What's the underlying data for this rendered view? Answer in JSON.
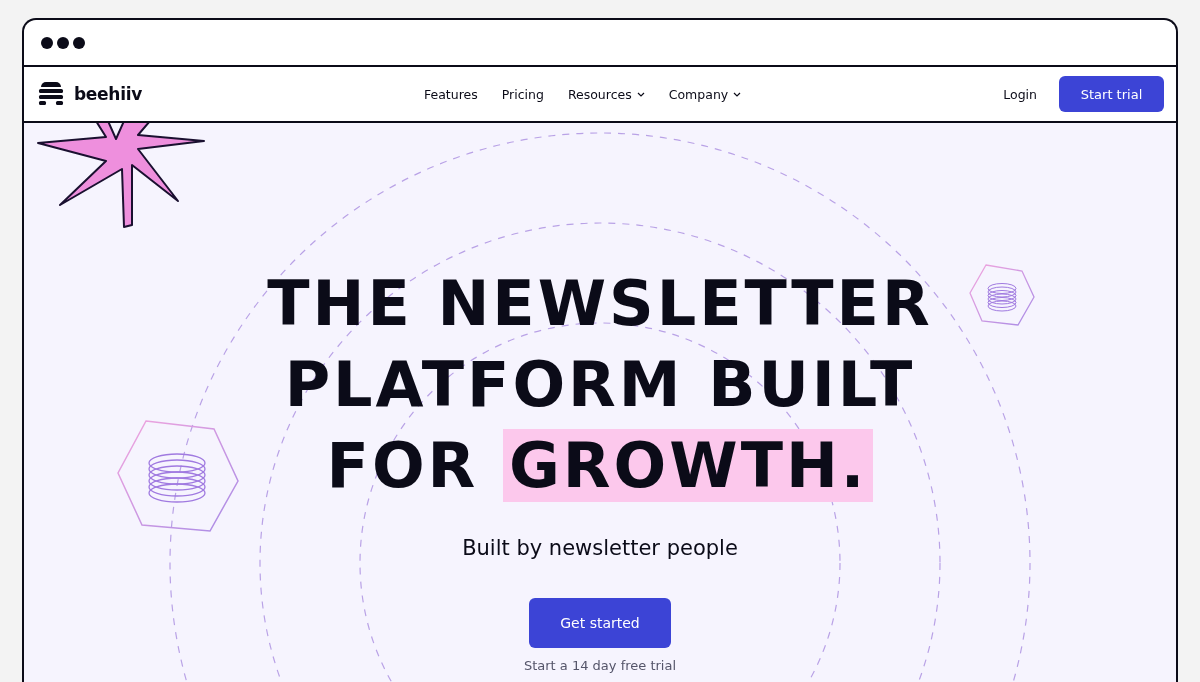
{
  "brand": {
    "name": "beehiiv"
  },
  "nav": {
    "links": [
      {
        "label": "Features",
        "has_dropdown": false
      },
      {
        "label": "Pricing",
        "has_dropdown": false
      },
      {
        "label": "Resources",
        "has_dropdown": true
      },
      {
        "label": "Company",
        "has_dropdown": true
      }
    ],
    "login": "Login",
    "cta": "Start trial"
  },
  "hero": {
    "headline_lines": [
      "THE NEWSLETTER",
      "PLATFORM BUILT"
    ],
    "headline_last": "FOR",
    "headline_highlight": "GROWTH.",
    "subtitle": "Built by newsletter people",
    "button": "Get started",
    "note": "Start a 14 day free trial"
  }
}
